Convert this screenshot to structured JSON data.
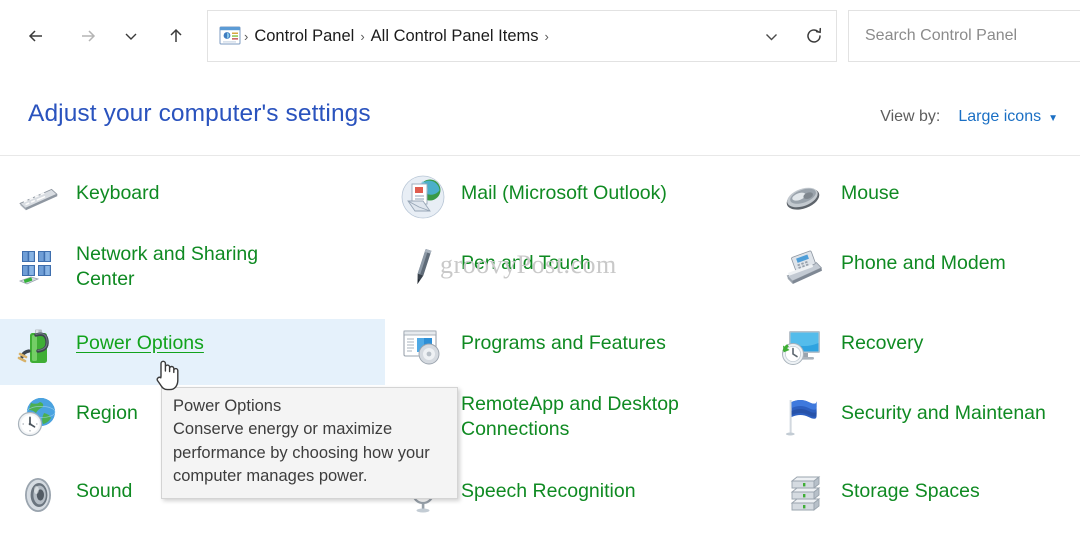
{
  "window": {
    "nav": {
      "back_label": "Back",
      "forward_label": "Forward",
      "recent_label": "Recent locations",
      "up_label": "Up one level"
    },
    "address": {
      "root_icon": "control-panel-icon",
      "crumbs": [
        "Control Panel",
        "All Control Panel Items"
      ],
      "separator": "›",
      "dropdown_label": "Previous locations",
      "refresh_label": "Refresh"
    },
    "search": {
      "placeholder": "Search Control Panel",
      "value": ""
    }
  },
  "header": {
    "title": "Adjust your computer's settings",
    "view_by_label": "View by:",
    "view_by_value": "Large icons",
    "view_by_caret": "▼"
  },
  "items": [
    {
      "id": "keyboard",
      "label": "Keyboard",
      "icon": "keyboard-icon",
      "col": 0,
      "row": 0,
      "wrapped": false,
      "hovered": false
    },
    {
      "id": "mail",
      "label": "Mail (Microsoft Outlook)",
      "icon": "mail-icon",
      "col": 1,
      "row": 0,
      "wrapped": false,
      "hovered": false
    },
    {
      "id": "mouse",
      "label": "Mouse",
      "icon": "mouse-icon",
      "col": 2,
      "row": 0,
      "wrapped": false,
      "hovered": false
    },
    {
      "id": "network-sharing",
      "label": "Network and Sharing\nCenter",
      "icon": "network-icon",
      "col": 0,
      "row": 1,
      "wrapped": true,
      "hovered": false
    },
    {
      "id": "pen-touch",
      "label": "Pen and Touch",
      "icon": "pen-icon",
      "col": 1,
      "row": 1,
      "wrapped": false,
      "hovered": false
    },
    {
      "id": "phone-modem",
      "label": "Phone and Modem",
      "icon": "fax-icon",
      "col": 2,
      "row": 1,
      "wrapped": false,
      "hovered": false
    },
    {
      "id": "power-options",
      "label": "Power Options",
      "icon": "battery-icon",
      "col": 0,
      "row": 2,
      "wrapped": false,
      "hovered": true
    },
    {
      "id": "programs-features",
      "label": "Programs and Features",
      "icon": "programs-icon",
      "col": 1,
      "row": 2,
      "wrapped": false,
      "hovered": false
    },
    {
      "id": "recovery",
      "label": "Recovery",
      "icon": "recovery-icon",
      "col": 2,
      "row": 2,
      "wrapped": false,
      "hovered": false
    },
    {
      "id": "region",
      "label": "Region",
      "icon": "region-icon",
      "col": 0,
      "row": 3,
      "wrapped": false,
      "hovered": false
    },
    {
      "id": "remoteapp",
      "label": "RemoteApp and Desktop\nConnections",
      "icon": "remoteapp-icon",
      "col": 1,
      "row": 3,
      "wrapped": true,
      "hovered": false
    },
    {
      "id": "security-maintenance",
      "label": "Security and Maintenan",
      "icon": "flag-icon",
      "col": 2,
      "row": 3,
      "wrapped": false,
      "hovered": false
    },
    {
      "id": "sound",
      "label": "Sound",
      "icon": "speaker-icon",
      "col": 0,
      "row": 4,
      "wrapped": false,
      "hovered": false
    },
    {
      "id": "speech-recognition",
      "label": "Speech Recognition",
      "icon": "microphone-icon",
      "col": 1,
      "row": 4,
      "wrapped": false,
      "hovered": false
    },
    {
      "id": "storage-spaces",
      "label": "Storage Spaces",
      "icon": "storage-icon",
      "col": 2,
      "row": 4,
      "wrapped": false,
      "hovered": false
    }
  ],
  "tooltip": {
    "title": "Power Options",
    "body": "Conserve energy or maximize performance by choosing how your computer manages power."
  },
  "watermark": {
    "text": "groovyPost.com"
  },
  "colors": {
    "link_green": "#0f8a22",
    "title_blue": "#2a53be",
    "accent_blue": "#1a6fc4",
    "hover_bg": "#e5f1fb",
    "tooltip_bg": "#f4f4f4",
    "watermark": "#c9c9c9"
  }
}
